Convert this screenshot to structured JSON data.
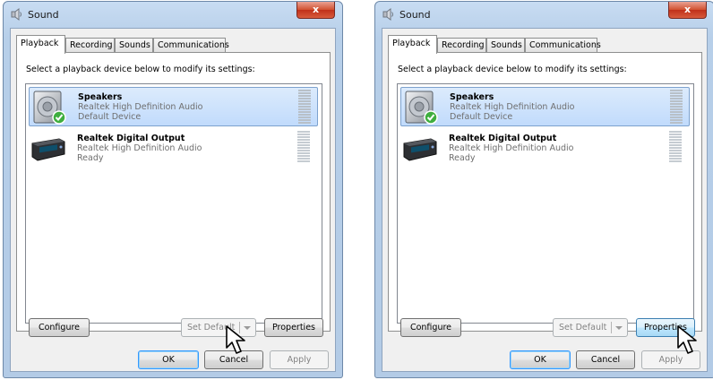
{
  "dialogs": [
    {
      "title": "Sound",
      "close_label": "x",
      "tabs": [
        "Playback",
        "Recording",
        "Sounds",
        "Communications"
      ],
      "instruction": "Select a playback device below to modify its settings:",
      "devices": [
        {
          "name": "Speakers",
          "driver": "Realtek High Definition Audio",
          "status": "Default Device",
          "selected": true,
          "icon": "speaker-icon"
        },
        {
          "name": "Realtek Digital Output",
          "driver": "Realtek High Definition Audio",
          "status": "Ready",
          "selected": false,
          "icon": "digital-output-icon"
        }
      ],
      "buttons": {
        "configure": "Configure",
        "set_default": "Set Default",
        "properties": "Properties",
        "ok": "OK",
        "cancel": "Cancel",
        "apply": "Apply"
      },
      "pointer_target": "set-default-button"
    },
    {
      "title": "Sound",
      "close_label": "x",
      "tabs": [
        "Playback",
        "Recording",
        "Sounds",
        "Communications"
      ],
      "instruction": "Select a playback device below to modify its settings:",
      "devices": [
        {
          "name": "Speakers",
          "driver": "Realtek High Definition Audio",
          "status": "Default Device",
          "selected": true,
          "icon": "speaker-icon"
        },
        {
          "name": "Realtek Digital Output",
          "driver": "Realtek High Definition Audio",
          "status": "Ready",
          "selected": false,
          "icon": "digital-output-icon"
        }
      ],
      "buttons": {
        "configure": "Configure",
        "set_default": "Set Default",
        "properties": "Properties",
        "ok": "OK",
        "cancel": "Cancel",
        "apply": "Apply"
      },
      "pointer_target": "properties-button"
    }
  ],
  "colors": {
    "selection": "#c1dbfc",
    "selection_border": "#7da2ce",
    "close": "#c0301a",
    "window_frame": "#b7cfe9"
  }
}
